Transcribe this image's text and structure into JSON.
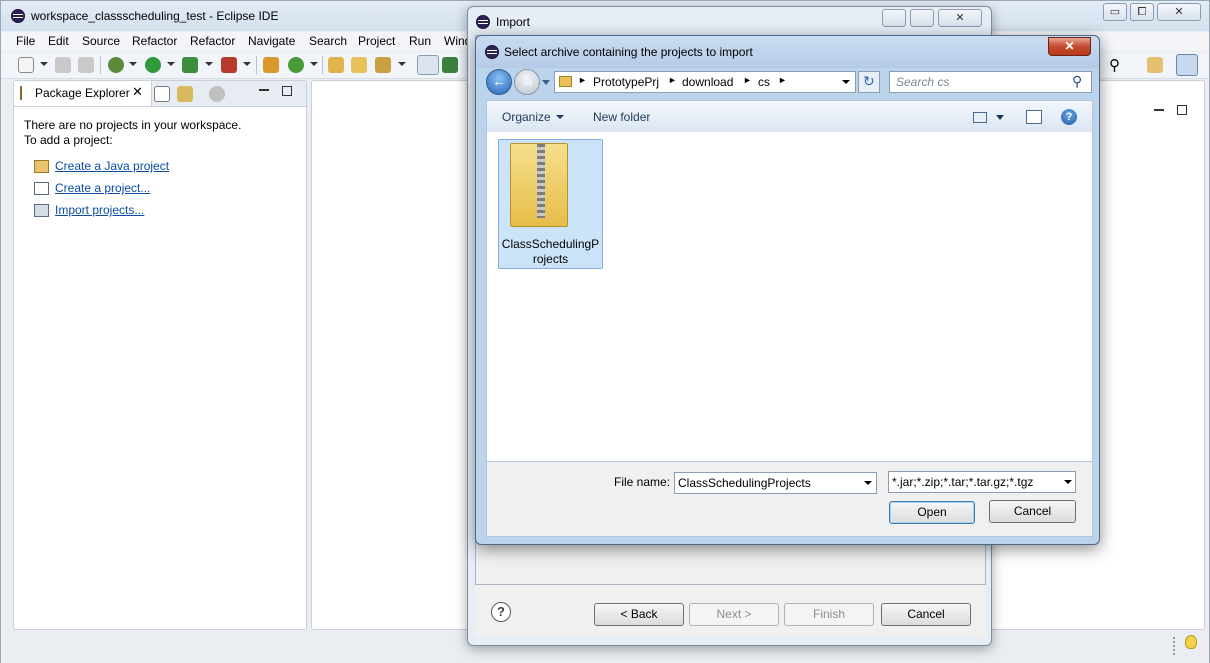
{
  "eclipse": {
    "title": "workspace_classscheduling_test - Eclipse IDE",
    "menu": [
      "File",
      "Edit",
      "Source",
      "Refactor",
      "Refactor",
      "Navigate",
      "Search",
      "Project",
      "Run",
      "Wind"
    ],
    "package_explorer": {
      "tab_label": "Package Explorer",
      "empty_line1": "There are no projects in your workspace.",
      "empty_line2": "To add a project:",
      "links": [
        "Create a Java project",
        "Create a project...",
        "Import projects..."
      ]
    },
    "window_buttons": {
      "minimize": "▭",
      "maximize": "⧠",
      "close": "✕"
    }
  },
  "import_dialog": {
    "title": "Import",
    "buttons": {
      "back": "< Back",
      "next": "Next >",
      "finish": "Finish",
      "cancel": "Cancel"
    },
    "help": "?"
  },
  "file_dialog": {
    "title": "Select archive containing the projects to import",
    "breadcrumb": [
      "PrototypePrj",
      "download",
      "cs"
    ],
    "search_placeholder": "Search cs",
    "organize_label": "Organize",
    "new_folder_label": "New folder",
    "file_item": {
      "name_line1": "ClassSchedulingP",
      "name_line2": "rojects"
    },
    "file_name_label": "File name:",
    "file_name_value": "ClassSchedulingProjects",
    "filter_value": "*.jar;*.zip;*.tar;*.tar.gz;*.tgz",
    "open_label": "Open",
    "cancel_label": "Cancel",
    "close_glyph": "✕"
  }
}
